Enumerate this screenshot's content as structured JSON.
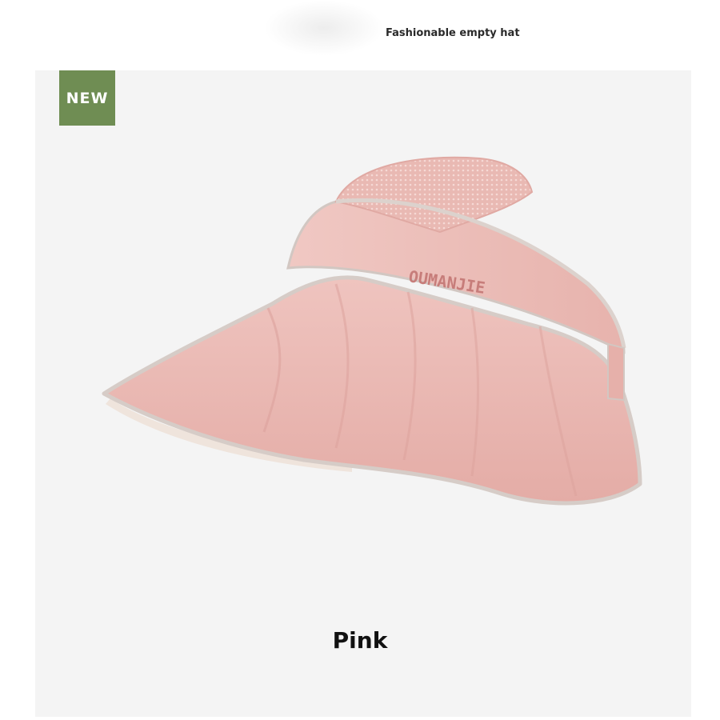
{
  "header": {
    "title": "Fashionable empty hat"
  },
  "badge": {
    "label": "NEW",
    "color": "#6f8d53"
  },
  "product": {
    "brand_embroidery": "OUMANJIE",
    "color_name": "Pink",
    "hat_color": "#ecbcb7",
    "trim_color": "#d8cfca"
  }
}
